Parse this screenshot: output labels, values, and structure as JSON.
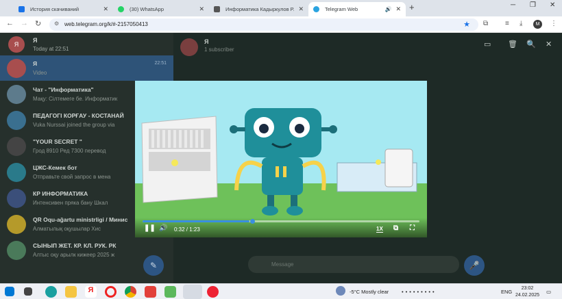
{
  "tabs": [
    {
      "title": "История скачиваний",
      "color": "#1a73e8"
    },
    {
      "title": "(30) WhatsApp",
      "color": "#25d366"
    },
    {
      "title": "Информатика Кадыркулов Р.",
      "color": "#555555"
    },
    {
      "title": "Telegram Web",
      "color": "#2aa3e0"
    }
  ],
  "window_controls": {
    "minimize": "─",
    "restore": "❐",
    "close": "✕"
  },
  "new_tab": "+",
  "url": "web.telegram.org/k/#-2157050413",
  "profile_initial": "M",
  "header": {
    "avatar": "Я",
    "name": "Я",
    "status": "Today at 22:51"
  },
  "chats": [
    {
      "name": "Я",
      "preview": "Video",
      "time": "22:51",
      "color": "#a84e4e",
      "selected": true
    },
    {
      "name": "Чат - \"Информатика\"",
      "preview": "Мақу: Сілтемеге бе. Информатик",
      "color": "#5d7b8c"
    },
    {
      "name": "ПЕДАГОГІ КОРҒАУ - КОСТАНАЙ",
      "preview": "Vuka Nurssai joined the group via",
      "color": "#3a6f8f"
    },
    {
      "name": "\"YOUR SECRET \"",
      "preview": "Грод 8910 Ред 7300 перевод",
      "color": "#444444"
    },
    {
      "name": "ЦЖС-Кемек бот",
      "preview": "Отправьте свой запрос в мена",
      "color": "#2a7a8a"
    },
    {
      "name": "КР ИНФОРМАТИКА",
      "preview": "Интенсивен пряка бану  Шкал",
      "color": "#3b4f7a"
    },
    {
      "name": "QR Oqu-ağartu ministrligi / Минис",
      "preview": "Алматылық оқушылар Хис",
      "color": "#b59a2a"
    },
    {
      "name": "СЫНЫП ЖЕТ. КР. КЛ. РУК. РК",
      "preview": "Алтыс оқу арылк кижеер 2025 ж",
      "color": "#4a7a5a"
    }
  ],
  "chat_title": {
    "name": "Я",
    "status": "1 subscriber"
  },
  "composer_placeholder": "Message",
  "video": {
    "current": "0:32",
    "duration": "1:23",
    "progress": 0.385,
    "speed": "1X"
  },
  "taskbar": {
    "weather": "-5°C  Mostly clear",
    "lang": "ENG",
    "time": "23:02",
    "date": "24.02.2025"
  }
}
